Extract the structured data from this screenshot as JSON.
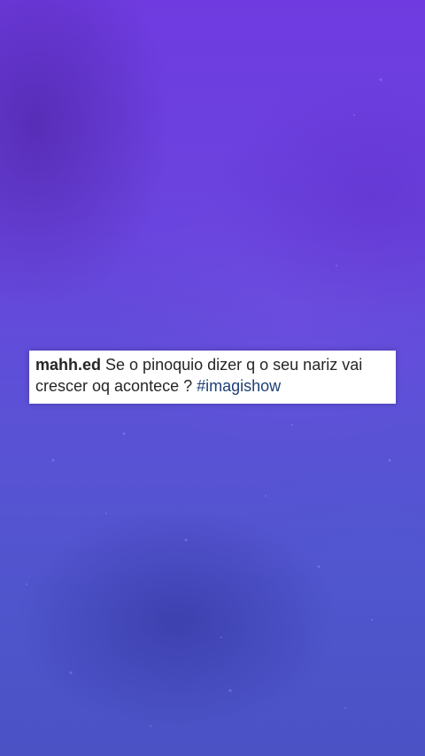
{
  "comment": {
    "username": "mahh.ed",
    "text": "Se o pinoquio dizer q o seu nariz vai crescer oq acontece ?",
    "hashtag": "#imagishow"
  },
  "colors": {
    "background_top": "#6f3be0",
    "background_bottom": "#4a52c4",
    "card_background": "#ffffff",
    "text": "#262626",
    "hashtag": "#1e3f75"
  }
}
